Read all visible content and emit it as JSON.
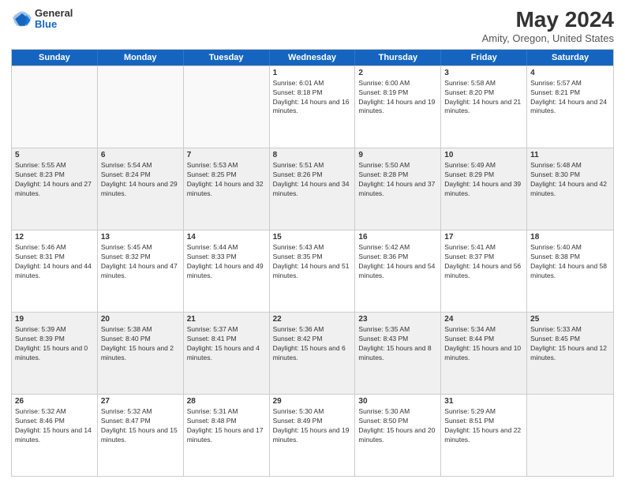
{
  "logo": {
    "general": "General",
    "blue": "Blue"
  },
  "title": "May 2024",
  "subtitle": "Amity, Oregon, United States",
  "header_days": [
    "Sunday",
    "Monday",
    "Tuesday",
    "Wednesday",
    "Thursday",
    "Friday",
    "Saturday"
  ],
  "weeks": [
    [
      {
        "day": "",
        "sunrise": "",
        "sunset": "",
        "daylight": "",
        "empty": true
      },
      {
        "day": "",
        "sunrise": "",
        "sunset": "",
        "daylight": "",
        "empty": true
      },
      {
        "day": "",
        "sunrise": "",
        "sunset": "",
        "daylight": "",
        "empty": true
      },
      {
        "day": "1",
        "sunrise": "Sunrise: 6:01 AM",
        "sunset": "Sunset: 8:18 PM",
        "daylight": "Daylight: 14 hours and 16 minutes."
      },
      {
        "day": "2",
        "sunrise": "Sunrise: 6:00 AM",
        "sunset": "Sunset: 8:19 PM",
        "daylight": "Daylight: 14 hours and 19 minutes."
      },
      {
        "day": "3",
        "sunrise": "Sunrise: 5:58 AM",
        "sunset": "Sunset: 8:20 PM",
        "daylight": "Daylight: 14 hours and 21 minutes."
      },
      {
        "day": "4",
        "sunrise": "Sunrise: 5:57 AM",
        "sunset": "Sunset: 8:21 PM",
        "daylight": "Daylight: 14 hours and 24 minutes."
      }
    ],
    [
      {
        "day": "5",
        "sunrise": "Sunrise: 5:55 AM",
        "sunset": "Sunset: 8:23 PM",
        "daylight": "Daylight: 14 hours and 27 minutes."
      },
      {
        "day": "6",
        "sunrise": "Sunrise: 5:54 AM",
        "sunset": "Sunset: 8:24 PM",
        "daylight": "Daylight: 14 hours and 29 minutes."
      },
      {
        "day": "7",
        "sunrise": "Sunrise: 5:53 AM",
        "sunset": "Sunset: 8:25 PM",
        "daylight": "Daylight: 14 hours and 32 minutes."
      },
      {
        "day": "8",
        "sunrise": "Sunrise: 5:51 AM",
        "sunset": "Sunset: 8:26 PM",
        "daylight": "Daylight: 14 hours and 34 minutes."
      },
      {
        "day": "9",
        "sunrise": "Sunrise: 5:50 AM",
        "sunset": "Sunset: 8:28 PM",
        "daylight": "Daylight: 14 hours and 37 minutes."
      },
      {
        "day": "10",
        "sunrise": "Sunrise: 5:49 AM",
        "sunset": "Sunset: 8:29 PM",
        "daylight": "Daylight: 14 hours and 39 minutes."
      },
      {
        "day": "11",
        "sunrise": "Sunrise: 5:48 AM",
        "sunset": "Sunset: 8:30 PM",
        "daylight": "Daylight: 14 hours and 42 minutes."
      }
    ],
    [
      {
        "day": "12",
        "sunrise": "Sunrise: 5:46 AM",
        "sunset": "Sunset: 8:31 PM",
        "daylight": "Daylight: 14 hours and 44 minutes."
      },
      {
        "day": "13",
        "sunrise": "Sunrise: 5:45 AM",
        "sunset": "Sunset: 8:32 PM",
        "daylight": "Daylight: 14 hours and 47 minutes."
      },
      {
        "day": "14",
        "sunrise": "Sunrise: 5:44 AM",
        "sunset": "Sunset: 8:33 PM",
        "daylight": "Daylight: 14 hours and 49 minutes."
      },
      {
        "day": "15",
        "sunrise": "Sunrise: 5:43 AM",
        "sunset": "Sunset: 8:35 PM",
        "daylight": "Daylight: 14 hours and 51 minutes."
      },
      {
        "day": "16",
        "sunrise": "Sunrise: 5:42 AM",
        "sunset": "Sunset: 8:36 PM",
        "daylight": "Daylight: 14 hours and 54 minutes."
      },
      {
        "day": "17",
        "sunrise": "Sunrise: 5:41 AM",
        "sunset": "Sunset: 8:37 PM",
        "daylight": "Daylight: 14 hours and 56 minutes."
      },
      {
        "day": "18",
        "sunrise": "Sunrise: 5:40 AM",
        "sunset": "Sunset: 8:38 PM",
        "daylight": "Daylight: 14 hours and 58 minutes."
      }
    ],
    [
      {
        "day": "19",
        "sunrise": "Sunrise: 5:39 AM",
        "sunset": "Sunset: 8:39 PM",
        "daylight": "Daylight: 15 hours and 0 minutes."
      },
      {
        "day": "20",
        "sunrise": "Sunrise: 5:38 AM",
        "sunset": "Sunset: 8:40 PM",
        "daylight": "Daylight: 15 hours and 2 minutes."
      },
      {
        "day": "21",
        "sunrise": "Sunrise: 5:37 AM",
        "sunset": "Sunset: 8:41 PM",
        "daylight": "Daylight: 15 hours and 4 minutes."
      },
      {
        "day": "22",
        "sunrise": "Sunrise: 5:36 AM",
        "sunset": "Sunset: 8:42 PM",
        "daylight": "Daylight: 15 hours and 6 minutes."
      },
      {
        "day": "23",
        "sunrise": "Sunrise: 5:35 AM",
        "sunset": "Sunset: 8:43 PM",
        "daylight": "Daylight: 15 hours and 8 minutes."
      },
      {
        "day": "24",
        "sunrise": "Sunrise: 5:34 AM",
        "sunset": "Sunset: 8:44 PM",
        "daylight": "Daylight: 15 hours and 10 minutes."
      },
      {
        "day": "25",
        "sunrise": "Sunrise: 5:33 AM",
        "sunset": "Sunset: 8:45 PM",
        "daylight": "Daylight: 15 hours and 12 minutes."
      }
    ],
    [
      {
        "day": "26",
        "sunrise": "Sunrise: 5:32 AM",
        "sunset": "Sunset: 8:46 PM",
        "daylight": "Daylight: 15 hours and 14 minutes."
      },
      {
        "day": "27",
        "sunrise": "Sunrise: 5:32 AM",
        "sunset": "Sunset: 8:47 PM",
        "daylight": "Daylight: 15 hours and 15 minutes."
      },
      {
        "day": "28",
        "sunrise": "Sunrise: 5:31 AM",
        "sunset": "Sunset: 8:48 PM",
        "daylight": "Daylight: 15 hours and 17 minutes."
      },
      {
        "day": "29",
        "sunrise": "Sunrise: 5:30 AM",
        "sunset": "Sunset: 8:49 PM",
        "daylight": "Daylight: 15 hours and 19 minutes."
      },
      {
        "day": "30",
        "sunrise": "Sunrise: 5:30 AM",
        "sunset": "Sunset: 8:50 PM",
        "daylight": "Daylight: 15 hours and 20 minutes."
      },
      {
        "day": "31",
        "sunrise": "Sunrise: 5:29 AM",
        "sunset": "Sunset: 8:51 PM",
        "daylight": "Daylight: 15 hours and 22 minutes."
      },
      {
        "day": "",
        "sunrise": "",
        "sunset": "",
        "daylight": "",
        "empty": true
      }
    ]
  ]
}
